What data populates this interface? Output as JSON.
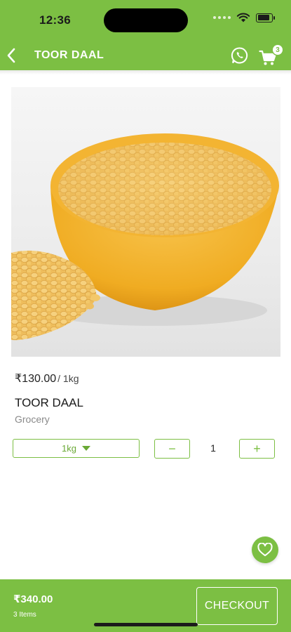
{
  "status_bar": {
    "time": "12:36"
  },
  "header": {
    "title": "TOOR DAAL",
    "back_icon": "chevron-left-icon",
    "whatsapp_icon": "whatsapp-icon",
    "cart_icon": "cart-icon",
    "cart_count": "3"
  },
  "product": {
    "price": "₹130.00",
    "unit": "/ 1kg",
    "name": "TOOR DAAL",
    "category": "Grocery",
    "variant_selected": "1kg",
    "quantity": "1",
    "minus_label": "−",
    "plus_label": "+"
  },
  "wishlist": {
    "icon": "heart-icon"
  },
  "bottom_bar": {
    "total": "₹340.00",
    "items_label": "3 Items",
    "checkout_label": "CHECKOUT"
  },
  "colors": {
    "brand_green": "#7cbf43",
    "background": "#ffffff",
    "muted_text": "#8a8a8a"
  }
}
